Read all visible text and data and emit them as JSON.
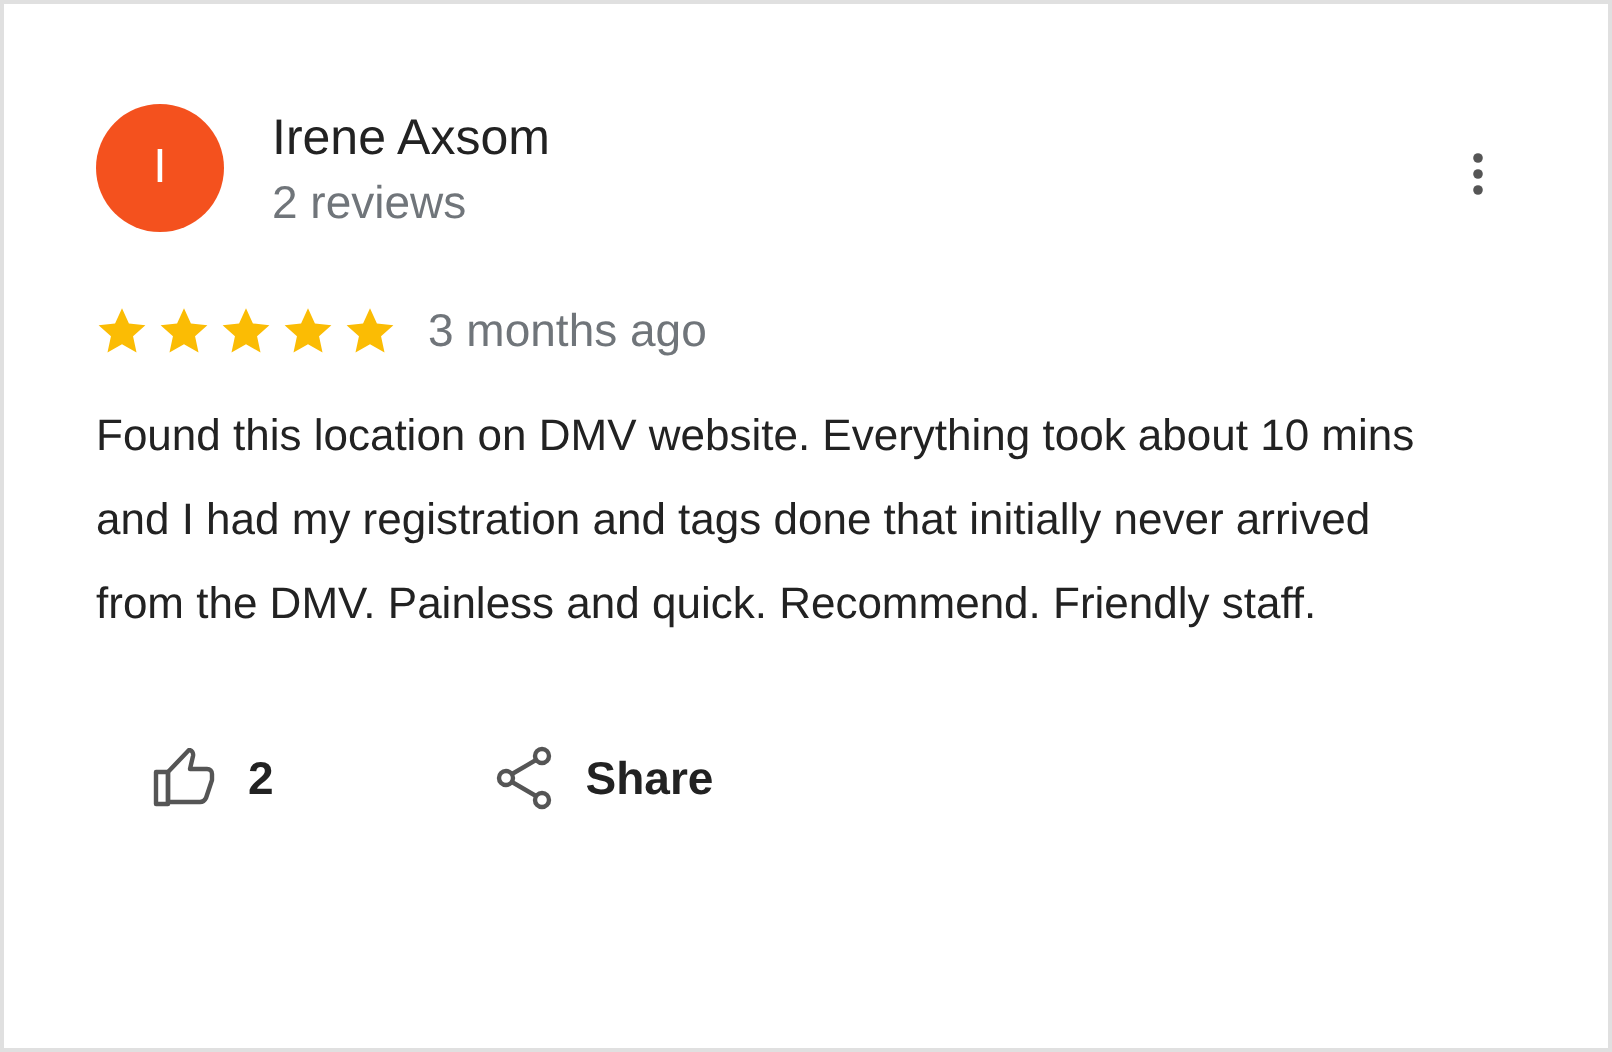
{
  "review": {
    "author": "Irene Axsom",
    "avatar_letter": "I",
    "author_meta": "2 reviews",
    "stars": 5,
    "time": "3 months ago",
    "text": "Found this location on DMV website. Everything took about 10 mins and I had my registration and tags done that initially never arrived from the DMV. Painless and quick. Recommend. Friendly staff.",
    "like_count": "2",
    "share_label": "Share"
  }
}
